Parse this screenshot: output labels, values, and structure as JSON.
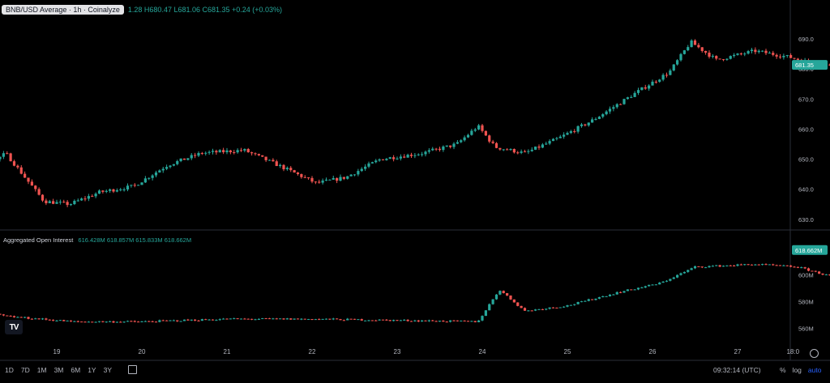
{
  "header": {
    "symbol_label": "BNB/USD Average · 1h · Coinalyze",
    "ohlc_text": "1.28 H680.47 L681.06 C681.35 +0.24 (+0.03%)"
  },
  "open_interest": {
    "title": "Aggregated Open Interest",
    "values_text": "616.428M 618.857M 615.833M 618.662M"
  },
  "time_axis": {
    "labels": [
      "19",
      "20",
      "21",
      "22",
      "23",
      "24",
      "25",
      "26",
      "27",
      "18:0"
    ]
  },
  "timeframes": [
    "1D",
    "7D",
    "1M",
    "3M",
    "6M",
    "1Y",
    "3Y"
  ],
  "status": {
    "time": "09:32:14 (UTC)",
    "percent_label": "%",
    "log_label": "log",
    "auto_label": "auto"
  },
  "logo_text": "TV",
  "colors": {
    "up": "#26a69a",
    "down": "#ef5350",
    "background": "#000000",
    "grid": "#1e222d",
    "price_tag": "#26a69a"
  },
  "chart_data": [
    {
      "type": "candlestick",
      "title": "BNB/USD Average · 1h · Coinalyze",
      "ylim": [
        627,
        697
      ],
      "y_ticks": [
        630.0,
        640.0,
        650.0,
        660.0,
        670.0,
        680.0,
        690.0
      ],
      "last_price_label": "681.35",
      "series": [
        {
          "name": "BNB/USD",
          "anchors": [
            [
              0,
              647
            ],
            [
              0.15,
              645
            ],
            [
              0.4,
              654
            ],
            [
              0.9,
              641
            ],
            [
              1.1,
              646
            ],
            [
              1.4,
              652
            ],
            [
              1.85,
              636
            ],
            [
              2.15,
              635
            ],
            [
              2.5,
              639
            ],
            [
              2.9,
              641
            ],
            [
              3.3,
              648
            ],
            [
              3.7,
              652
            ],
            [
              4.2,
              653
            ],
            [
              4.6,
              648
            ],
            [
              5.05,
              642
            ],
            [
              5.4,
              644
            ],
            [
              5.8,
              650
            ],
            [
              6.3,
              652
            ],
            [
              6.7,
              655
            ],
            [
              6.95,
              661
            ],
            [
              7.15,
              654
            ],
            [
              7.5,
              652
            ],
            [
              7.9,
              657
            ],
            [
              8.3,
              663
            ],
            [
              8.8,
              672
            ],
            [
              9.2,
              679
            ],
            [
              9.45,
              689
            ],
            [
              9.75,
              683
            ],
            [
              10.2,
              686
            ],
            [
              10.6,
              684
            ],
            [
              11.0,
              681
            ],
            [
              11.4,
              683
            ],
            [
              11.75,
              687
            ],
            [
              12.0,
              689
            ],
            [
              12.3,
              685
            ],
            [
              12.55,
              687
            ],
            [
              12.75,
              676
            ],
            [
              13.1,
              673
            ],
            [
              13.5,
              667
            ],
            [
              13.9,
              662
            ],
            [
              14.2,
              656
            ],
            [
              14.6,
              664
            ],
            [
              15.1,
              673
            ],
            [
              15.4,
              676
            ],
            [
              15.8,
              674
            ],
            [
              16.2,
              675
            ],
            [
              16.6,
              668
            ],
            [
              16.9,
              664
            ],
            [
              17.3,
              664
            ],
            [
              17.6,
              658
            ],
            [
              17.9,
              661
            ],
            [
              18.3,
              663
            ],
            [
              18.8,
              666
            ],
            [
              19.25,
              670
            ],
            [
              19.8,
              674
            ],
            [
              20.3,
              675
            ],
            [
              20.8,
              676
            ],
            [
              21.2,
              673
            ],
            [
              21.6,
              674
            ],
            [
              22.0,
              672
            ],
            [
              22.3,
              675
            ],
            [
              22.6,
              679
            ],
            [
              22.75,
              682
            ]
          ]
        }
      ]
    },
    {
      "type": "candlestick",
      "title": "Aggregated Open Interest",
      "ylim": [
        550,
        624
      ],
      "y_ticks": [
        560.0,
        580.0,
        600.0
      ],
      "unit": "M",
      "last_value_label": "618.662M",
      "series": [
        {
          "name": "Aggregated Open Interest",
          "anchors": [
            [
              0,
              573
            ],
            [
              0.8,
              577
            ],
            [
              1.4,
              569
            ],
            [
              2.2,
              565
            ],
            [
              3.0,
              565
            ],
            [
              4.0,
              567
            ],
            [
              5.0,
              567
            ],
            [
              6.0,
              566
            ],
            [
              6.95,
              565
            ],
            [
              7.2,
              589
            ],
            [
              7.5,
              573
            ],
            [
              8.0,
              577
            ],
            [
              8.6,
              587
            ],
            [
              9.1,
              594
            ],
            [
              9.5,
              606
            ],
            [
              10.2,
              608
            ],
            [
              10.7,
              606
            ],
            [
              11.1,
              599
            ],
            [
              11.6,
              603
            ],
            [
              12.0,
              607
            ],
            [
              12.4,
              603
            ],
            [
              12.75,
              600
            ],
            [
              13.0,
              590
            ],
            [
              13.5,
              584
            ],
            [
              14.2,
              580
            ],
            [
              14.6,
              583
            ],
            [
              15.0,
              589
            ],
            [
              15.4,
              597
            ],
            [
              16.0,
              601
            ],
            [
              16.5,
              605
            ],
            [
              17.0,
              603
            ],
            [
              17.4,
              606
            ],
            [
              17.9,
              598
            ],
            [
              18.3,
              601
            ],
            [
              18.8,
              599
            ],
            [
              19.5,
              600
            ],
            [
              20.0,
              596
            ],
            [
              20.5,
              599
            ],
            [
              21.0,
              600
            ],
            [
              21.5,
              600
            ],
            [
              22.0,
              600
            ],
            [
              22.4,
              610
            ],
            [
              22.75,
              619
            ]
          ]
        }
      ]
    }
  ]
}
